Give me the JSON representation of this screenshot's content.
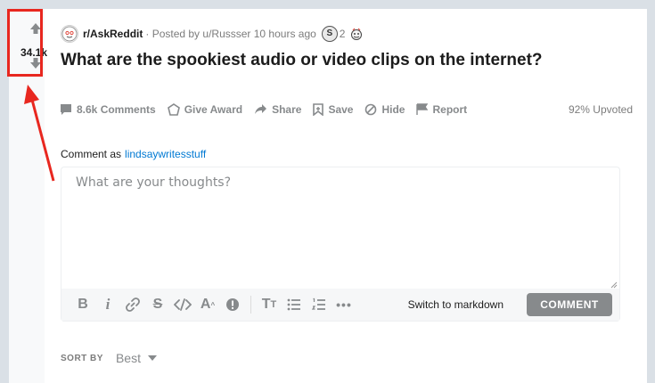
{
  "vote": {
    "score": "34.1k"
  },
  "post": {
    "subreddit": "r/AskReddit",
    "posted_by": "· Posted by u/Russser 10 hours ago",
    "award_count": "2",
    "title": "What are the spookiest audio or video clips on the internet?",
    "upvoted_pct": "92% Upvoted"
  },
  "actions": {
    "comments": "8.6k Comments",
    "give_award": "Give Award",
    "share": "Share",
    "save": "Save",
    "hide": "Hide",
    "report": "Report"
  },
  "comment_box": {
    "comment_as_label": "Comment as",
    "username": "lindsaywritesstuff",
    "placeholder": "What are your thoughts?",
    "switch_markdown": "Switch to markdown",
    "submit_label": "COMMENT"
  },
  "toolbar_icons": [
    "bold-icon",
    "italic-icon",
    "link-icon",
    "strikethrough-icon",
    "inline-code-icon",
    "superscript-icon",
    "spoiler-icon",
    "heading-icon",
    "bulleted-list-icon",
    "numbered-list-icon",
    "more-icon"
  ],
  "sort": {
    "label": "SORT BY",
    "value": "Best"
  },
  "colors": {
    "highlight": "#e8271f",
    "link": "#0079d3",
    "muted": "#878a8c"
  }
}
